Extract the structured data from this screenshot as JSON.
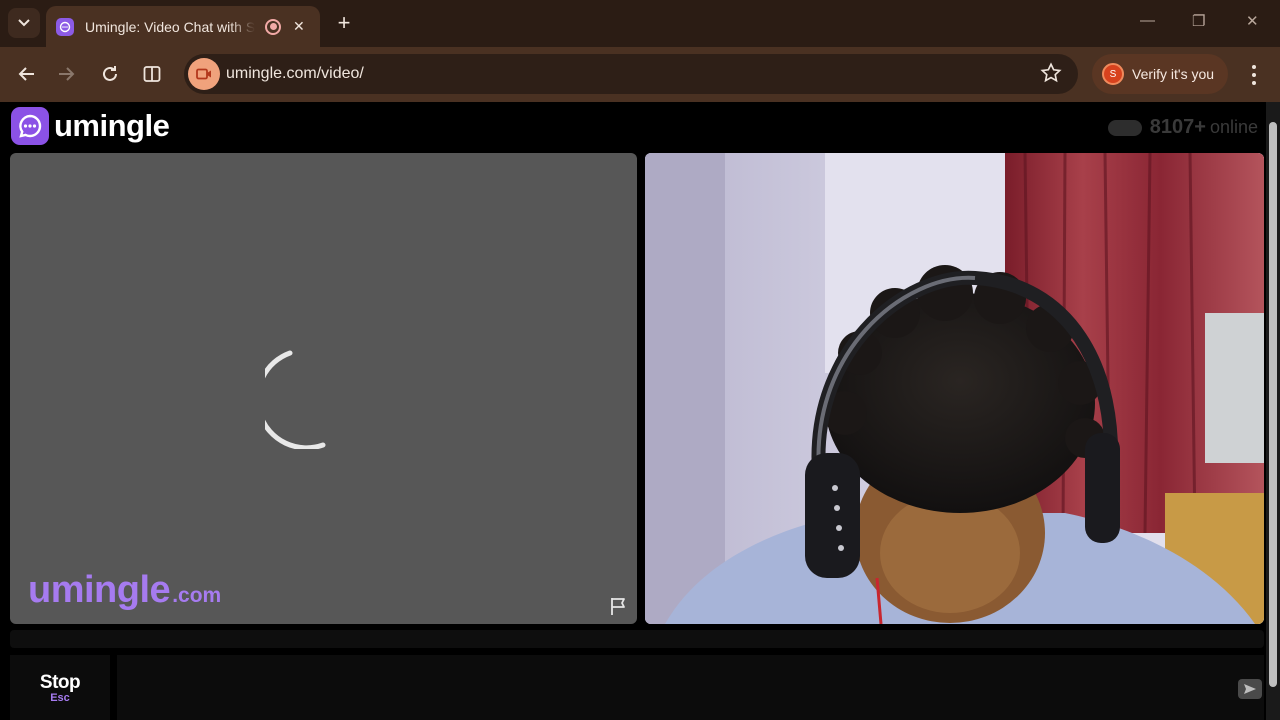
{
  "browser": {
    "tab": {
      "title": "Umingle: Video Chat with Strangers"
    },
    "new_tab_label": "+",
    "window_controls": {
      "minimize": "—",
      "restore": "❐",
      "close": "✕"
    },
    "url": "umingle.com/video/",
    "verify_label": "Verify it's you",
    "verify_avatar_letter": "S",
    "colors": {
      "chrome_bg": "#2b1c14",
      "toolbar_bg": "#4a3122",
      "accent": "#f0a27c"
    }
  },
  "page": {
    "logo_text": "umingle",
    "online_count": "8107+",
    "online_label": "online",
    "watermark_main": "umingle",
    "watermark_domain": ".com",
    "stop_label": "Stop",
    "stop_shortcut": "Esc",
    "colors": {
      "brand": "#8b52e6",
      "watermark": "#a67bf0",
      "panel_bg": "#575757"
    }
  }
}
